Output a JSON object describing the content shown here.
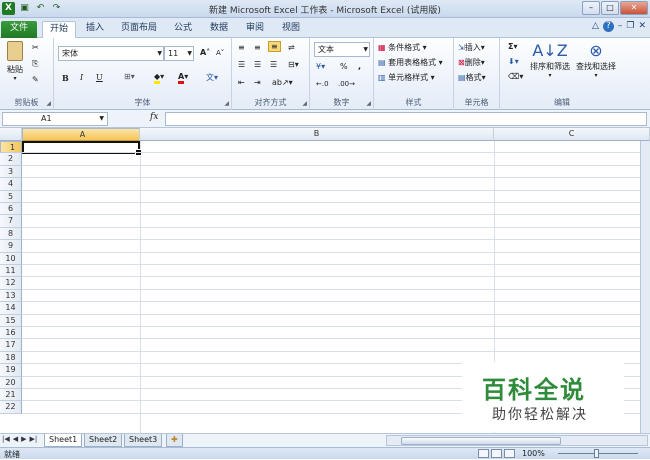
{
  "title": "新建 Microsoft Excel 工作表 - Microsoft Excel (试用版)",
  "tabs": [
    "文件",
    "开始",
    "插入",
    "页面布局",
    "公式",
    "数据",
    "审阅",
    "视图"
  ],
  "active_tab": "开始",
  "clipboard": {
    "paste": "粘贴",
    "label": "剪贴板"
  },
  "font": {
    "name": "宋体",
    "size": "11",
    "label": "字体",
    "bold": "B",
    "italic": "I",
    "underline": "U"
  },
  "alignment": {
    "label": "对齐方式"
  },
  "number": {
    "format": "文本",
    "percent": "%",
    "comma": ",",
    "label": "数字"
  },
  "styles": {
    "conditional": "条件格式",
    "table": "套用表格格式",
    "cell": "单元格样式",
    "label": "样式"
  },
  "cells": {
    "insert": "插入",
    "delete": "删除",
    "format": "格式",
    "label": "单元格"
  },
  "editing": {
    "sort": "排序和筛选",
    "find": "查找和选择",
    "label": "编辑",
    "sum": "Σ"
  },
  "formula_bar": {
    "namebox": "A1",
    "fx": "fx",
    "value": ""
  },
  "columns": [
    "A",
    "B",
    "C"
  ],
  "rows": [
    "1",
    "2",
    "3",
    "4",
    "5",
    "6",
    "7",
    "8",
    "9",
    "10",
    "11",
    "12",
    "13",
    "14",
    "15",
    "16",
    "17",
    "18",
    "19",
    "20",
    "21",
    "22"
  ],
  "sheets": [
    "Sheet1",
    "Sheet2",
    "Sheet3"
  ],
  "status": {
    "ready": "就绪",
    "zoom": "100%"
  },
  "watermark": {
    "line1": "百科全说",
    "line2": "助你轻松解决"
  },
  "colors": {
    "file_tab": "#1f7a23",
    "selected_header": "#f5c55a",
    "watermark": "#2e8b3a"
  }
}
